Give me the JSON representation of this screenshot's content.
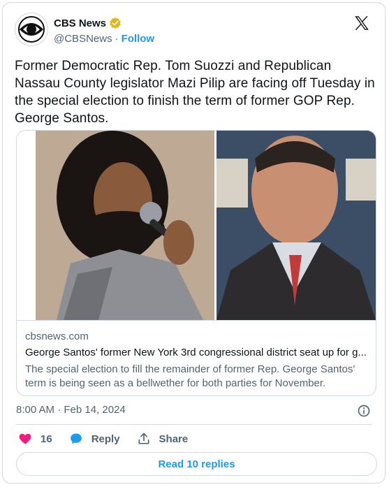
{
  "account": {
    "display_name": "CBS News",
    "handle": "@CBSNews",
    "separator": "·",
    "follow_label": "Follow"
  },
  "tweet": {
    "text": "Former Democratic Rep. Tom Suozzi and Republican Nassau County legislator Mazi Pilip are facing off Tuesday in the special election to finish the term of former GOP Rep. George Santos."
  },
  "link_card": {
    "domain": "cbsnews.com",
    "title": "George Santos' former New York 3rd congressional district seat up for g...",
    "description": "The special election to fill the remainder of former Rep. George Santos' term is being seen as a bellwether for both parties for November."
  },
  "meta": {
    "timestamp": "8:00 AM · Feb 14, 2024"
  },
  "actions": {
    "like_count": "16",
    "reply_label": "Reply",
    "share_label": "Share"
  },
  "read_replies_label": "Read 10 replies",
  "colors": {
    "accent": "#1d9bf0",
    "like": "#f91880",
    "verified": "#e2b719",
    "border": "#cfd9de",
    "muted": "#536471"
  }
}
